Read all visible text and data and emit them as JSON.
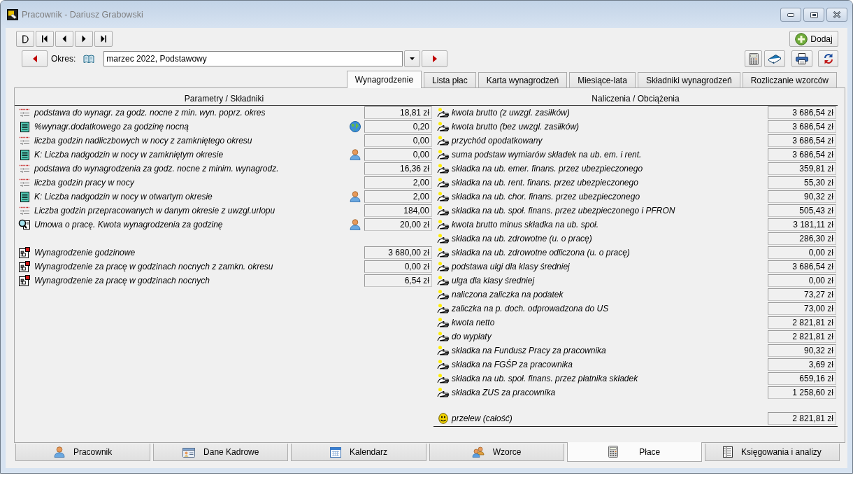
{
  "window": {
    "title": "Pracownik - Dariusz Grabowski"
  },
  "toolbar": {
    "add_button": "Dodaj"
  },
  "period": {
    "label": "Okres:",
    "value": "marzec 2022, Podstawowy"
  },
  "tabs": [
    {
      "label": "Wynagrodzenie",
      "selected": true
    },
    {
      "label": "Lista płac",
      "selected": false
    },
    {
      "label": "Karta wynagrodzeń",
      "selected": false
    },
    {
      "label": "Miesiące-lata",
      "selected": false
    },
    {
      "label": "Składniki wynagrodzeń",
      "selected": false
    },
    {
      "label": "Rozliczanie wzorców",
      "selected": false
    }
  ],
  "parameters": {
    "header": "Parametry / Składniki",
    "groups": [
      {
        "rows": [
          {
            "kind": "parameter",
            "label": "podstawa do wynagr. za godz. nocne z min. wyn. poprz. okres",
            "value": "18,81 zł"
          },
          {
            "kind": "table",
            "label": "%wynagr.dodatkowego za godzinę nocną",
            "marker": {
              "kind": "globe"
            },
            "value": "0,20"
          },
          {
            "kind": "parameter",
            "label": "liczba godzin nadliczbowych w nocy z zamkniętego okresu",
            "value": "0,00"
          },
          {
            "kind": "table",
            "label": "K: Liczba nadgodzin w nocy w zamkniętym okresie",
            "marker": {
              "kind": "person"
            },
            "value": "0,00"
          },
          {
            "kind": "parameter",
            "label": "podstawa do wynagrodzenia za godz. nocne z minim. wynagrodz.",
            "value": "16,36 zł"
          },
          {
            "kind": "parameter",
            "label": "liczba godzin pracy w nocy",
            "value": "2,00"
          },
          {
            "kind": "table",
            "label": "K: Liczba nadgodzin w nocy w otwartym okresie",
            "marker": {
              "kind": "person"
            },
            "value": "2,00"
          },
          {
            "kind": "parameter",
            "label": "Liczba godzin przepracowanych w danym okresie z uwzgl.urlopu",
            "value": "184,00"
          },
          {
            "kind": "contract",
            "label": "Umowa o pracę. Kwota wynagrodzenia za godzinę",
            "marker": {
              "kind": "person"
            },
            "value": "20,00 zł"
          }
        ]
      },
      {
        "rows": [
          {
            "kind": "component",
            "label": "Wynagrodzenie godzinowe",
            "value": "3 680,00 zł"
          },
          {
            "kind": "component",
            "label": "Wynagrodzenie za pracę w godzinach nocnych z zamkn. okresu",
            "value": "0,00 zł"
          },
          {
            "kind": "component",
            "label": "Wynagrodzenie za pracę w godzinach nocnych",
            "value": "6,54 zł"
          }
        ]
      }
    ]
  },
  "charges": {
    "header": "Naliczenia / Obciążenia",
    "groups": [
      {
        "rows": [
          {
            "kind": "charge",
            "label": "kwota brutto (z uwzgl. zasiłków)",
            "value": "3 686,54 zł"
          },
          {
            "kind": "charge",
            "label": "kwota brutto (bez uwzgl. zasiłków)",
            "value": "3 686,54 zł"
          },
          {
            "kind": "charge",
            "label": "przychód opodatkowany",
            "value": "3 686,54 zł"
          },
          {
            "kind": "charge",
            "label": "suma podstaw wymiarów składek na ub. em. i rent.",
            "value": "3 686,54 zł"
          },
          {
            "kind": "charge",
            "label": "składka na ub. emer. finans. przez ubezpieczonego",
            "value": "359,81 zł"
          },
          {
            "kind": "charge",
            "label": "składka na ub. rent. finans. przez ubezpieczonego",
            "value": "55,30 zł"
          },
          {
            "kind": "charge",
            "label": "składka na ub. chor. finans. przez ubezpieczonego",
            "value": "90,32 zł"
          },
          {
            "kind": "charge",
            "label": "składka na ub. społ. finans. przez ubezpieczonego i PFRON",
            "value": "505,43 zł"
          },
          {
            "kind": "charge",
            "label": "kwota brutto minus składka na ub. społ.",
            "value": "3 181,11 zł"
          },
          {
            "kind": "charge",
            "label": "składka na ub. zdrowotne (u. o pracę)",
            "value": "286,30 zł"
          },
          {
            "kind": "charge",
            "label": "składka na ub. zdrowotne odliczona (u. o pracę)",
            "value": "0,00 zł"
          },
          {
            "kind": "charge",
            "label": "podstawa ulgi dla klasy średniej",
            "value": "3 686,54 zł"
          },
          {
            "kind": "charge",
            "label": "ulga dla klasy średniej",
            "value": "0,00 zł"
          },
          {
            "kind": "charge",
            "label": "naliczona zaliczka na podatek",
            "value": "73,27 zł"
          },
          {
            "kind": "charge",
            "label": "zaliczka na p. doch. odprowadzona do US",
            "value": "73,00 zł"
          },
          {
            "kind": "charge",
            "label": "kwota netto",
            "value": "2 821,81 zł"
          },
          {
            "kind": "charge",
            "label": "do wypłaty",
            "value": "2 821,81 zł"
          },
          {
            "kind": "charge",
            "label": "składka na Fundusz Pracy za pracownika",
            "value": "90,32 zł"
          },
          {
            "kind": "charge",
            "label": "składka na FGŚP za pracownika",
            "value": "3,69 zł"
          },
          {
            "kind": "charge",
            "label": "składka na ub. społ. finans. przez płatnika składek",
            "value": "659,16 zł"
          },
          {
            "kind": "charge",
            "label": "składka ZUS za pracownika",
            "value": "1 258,60 zł"
          }
        ]
      },
      {
        "rows": [
          {
            "kind": "transfer",
            "label": "przelew (całość)",
            "value": "2 821,81 zł"
          }
        ]
      }
    ]
  },
  "bottom_tabs": [
    {
      "label": "Pracownik",
      "selected": false
    },
    {
      "label": "Dane Kadrowe",
      "selected": false
    },
    {
      "label": "Kalendarz",
      "selected": false
    },
    {
      "label": "Wzorce",
      "selected": false
    },
    {
      "label": "Płace",
      "selected": true
    },
    {
      "label": "Księgowania i analizy",
      "selected": false
    }
  ]
}
